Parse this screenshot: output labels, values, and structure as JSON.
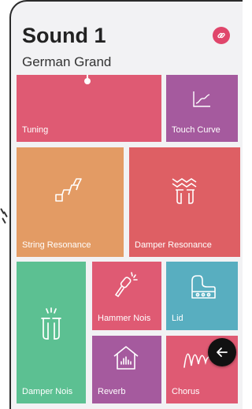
{
  "header": {
    "title": "Sound 1",
    "subtitle": "German Grand",
    "link_icon": "link-icon"
  },
  "tiles": {
    "tuning": {
      "label": "Tuning",
      "color": "#df5a73"
    },
    "touch_curve": {
      "label": "Touch Curve",
      "icon": "graph-icon",
      "color": "#a55a9e"
    },
    "string_resonance": {
      "label": "String Resonance",
      "icon": "string-icon",
      "color": "#e39b64"
    },
    "damper_resonance": {
      "label": "Damper Resonance",
      "icon": "damper-resonance-icon",
      "color": "#de5f64"
    },
    "damper_noise": {
      "label": "Damper Nois",
      "icon": "damper-icon",
      "color": "#5cc092"
    },
    "hammer_noise": {
      "label": "Hammer Nois",
      "icon": "hammer-icon",
      "color": "#df5a73"
    },
    "lid": {
      "label": "Lid",
      "icon": "piano-lid-icon",
      "color": "#58aec0"
    },
    "reverb": {
      "label": "Reverb",
      "icon": "house-reverb-icon",
      "color": "#a55a9e"
    },
    "chorus": {
      "label": "Chorus",
      "icon": "chorus-wave-icon",
      "color": "#df5a73"
    }
  },
  "back_button": {
    "icon": "arrow-left-icon"
  }
}
